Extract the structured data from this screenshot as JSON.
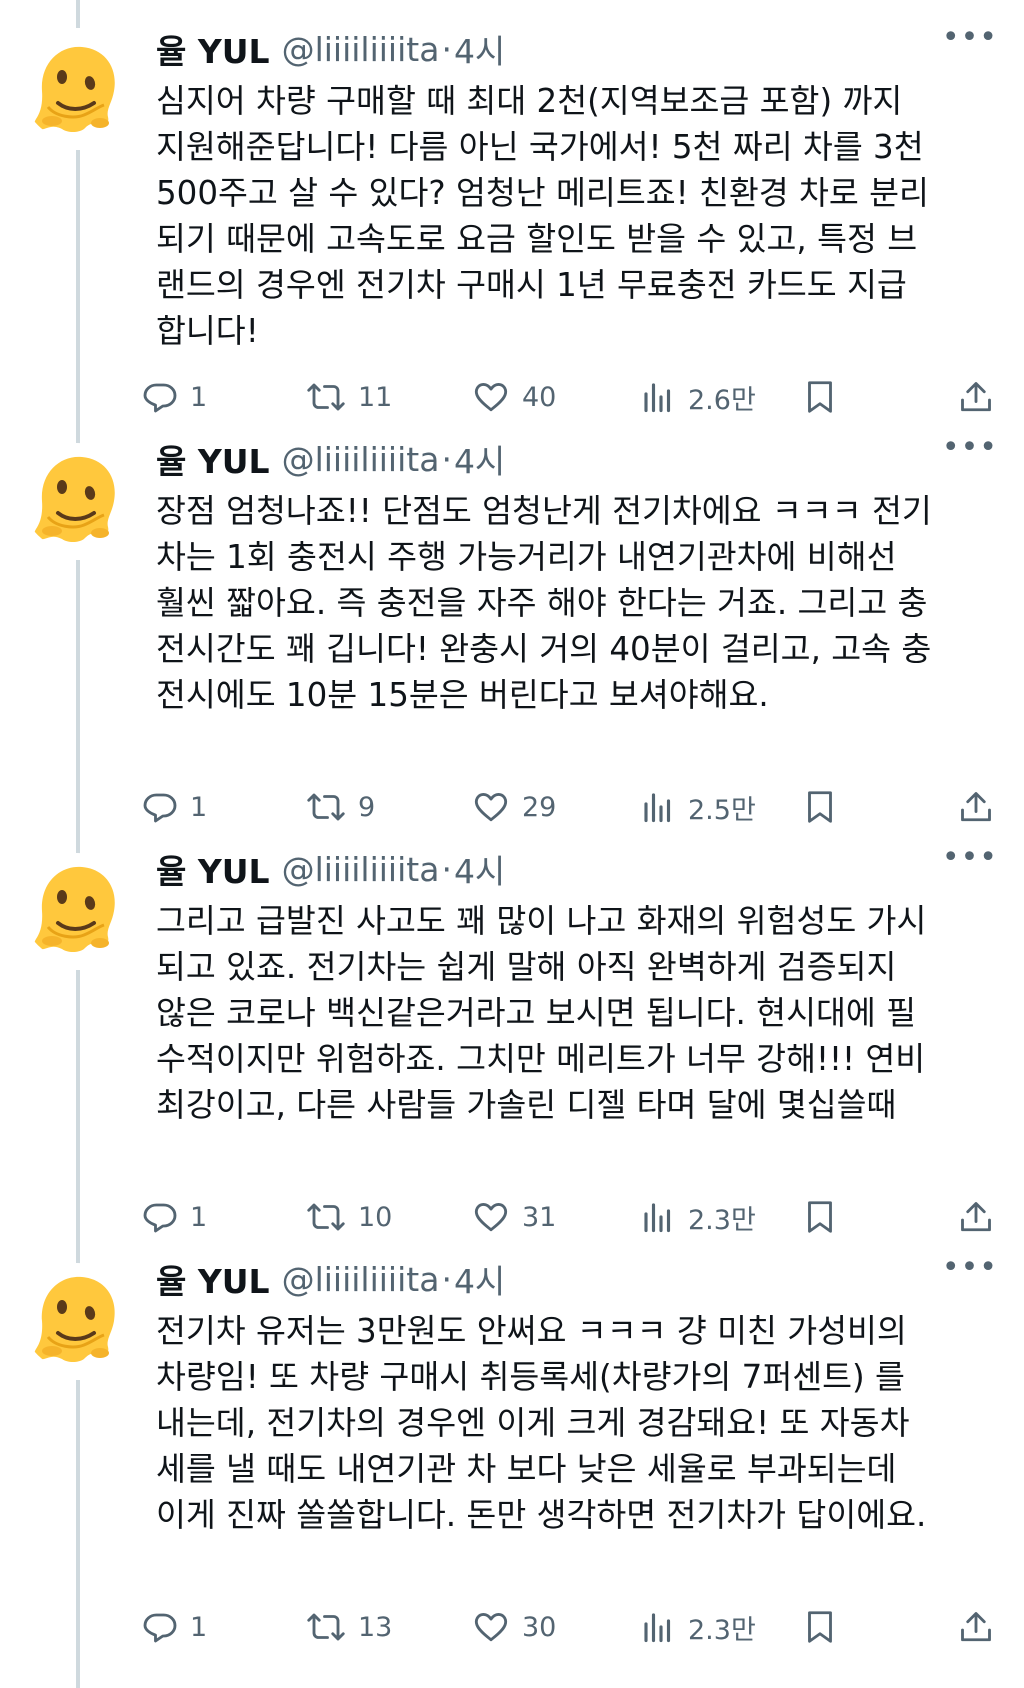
{
  "tweets": [
    {
      "name": "율 YUL",
      "handle": "@liiiiliiiita",
      "dot": "·",
      "time": "4시",
      "text": "심지어 차량 구매할 때 최대 2천(지역보조금 포함) 까지\n지원해준답니다! 다름 아닌 국가에서! 5천 짜리 차를 3천\n500주고 살 수 있다? 엄청난 메리트죠! 친환경 차로 분리\n되기 때문에 고속도로 요금 할인도 받을 수 있고, 특정 브\n랜드의 경우엔 전기차 구매시 1년 무료충전 카드도 지급\n합니다!",
      "replies": "1",
      "retweets": "11",
      "likes": "40",
      "views": "2.6만"
    },
    {
      "name": "율 YUL",
      "handle": "@liiiiliiiita",
      "dot": "·",
      "time": "4시",
      "text": "장점 엄청나죠!! 단점도 엄청난게 전기차에요 ㅋㅋㅋ 전기\n차는 1회 충전시 주행 가능거리가 내연기관차에 비해선\n훨씬 짧아요. 즉 충전을 자주 해야 한다는 거죠. 그리고 충\n전시간도 꽤 깁니다! 완충시 거의 40분이 걸리고, 고속 충\n전시에도 10분 15분은 버린다고 보셔야해요.",
      "replies": "1",
      "retweets": "9",
      "likes": "29",
      "views": "2.5만"
    },
    {
      "name": "율 YUL",
      "handle": "@liiiiliiiita",
      "dot": "·",
      "time": "4시",
      "text": "그리고 급발진 사고도 꽤 많이 나고 화재의 위험성도 가시\n되고 있죠. 전기차는 쉽게 말해 아직 완벽하게 검증되지\n않은 코로나 백신같은거라고 보시면 됩니다. 현시대에 필\n수적이지만 위험하죠. 그치만 메리트가 너무 강해!!! 연비\n최강이고, 다른 사람들 가솔린 디젤 타며 달에 몇십쓸때",
      "replies": "1",
      "retweets": "10",
      "likes": "31",
      "views": "2.3만"
    },
    {
      "name": "율 YUL",
      "handle": "@liiiiliiiita",
      "dot": "·",
      "time": "4시",
      "text": "전기차 유저는 3만원도 안써요 ㅋㅋㅋ 걍 미친 가성비의\n차량임! 또 차량 구매시 취등록세(차량가의 7퍼센트) 를\n내는데, 전기차의 경우엔 이게 크게 경감돼요! 또 자동차\n세를 낼 때도 내연기관 차 보다 낮은 세율로 부과되는데\n이게 진짜 쏠쏠합니다. 돈만 생각하면 전기차가 답이에요.",
      "replies": "1",
      "retweets": "13",
      "likes": "30",
      "views": "2.3만"
    }
  ],
  "more_label": "•••",
  "colors": {
    "text": "#0f1419",
    "secondary": "#536471",
    "thread": "#cfd9de",
    "avatar_yellow": "#ffc83d"
  },
  "icons": [
    "melting-face-avatar",
    "more-icon",
    "reply-icon",
    "retweet-icon",
    "like-icon",
    "views-icon",
    "bookmark-icon",
    "share-icon"
  ]
}
